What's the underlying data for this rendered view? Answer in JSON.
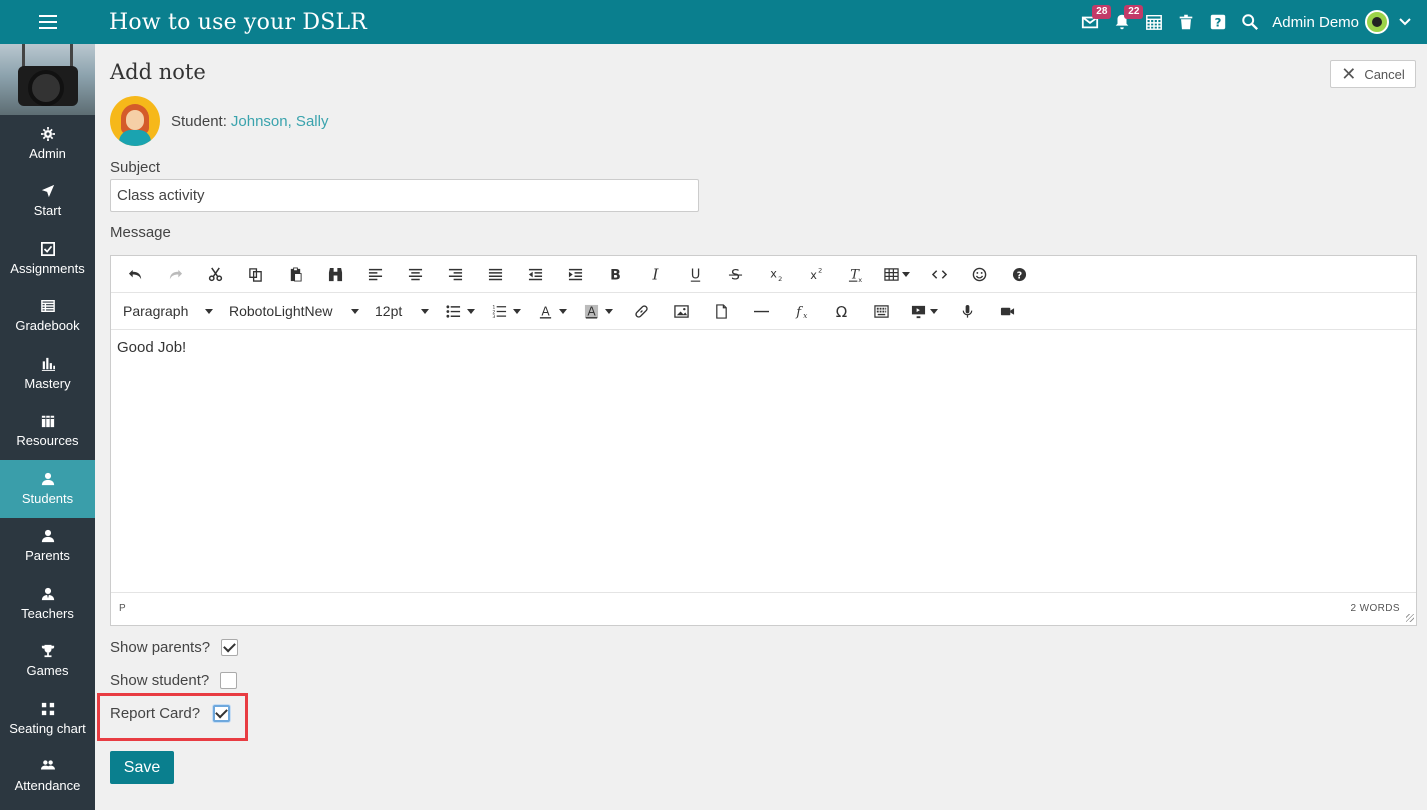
{
  "header": {
    "title": "How to use your DSLR",
    "messages_badge": "28",
    "notifications_badge": "22",
    "user_name": "Admin Demo"
  },
  "sidebar": {
    "items": [
      {
        "label": "Admin",
        "icon": "gear-icon"
      },
      {
        "label": "Start",
        "icon": "navigation-arrow-icon"
      },
      {
        "label": "Assignments",
        "icon": "checkbox-icon"
      },
      {
        "label": "Gradebook",
        "icon": "gradebook-icon"
      },
      {
        "label": "Mastery",
        "icon": "bar-chart-icon"
      },
      {
        "label": "Resources",
        "icon": "books-icon"
      },
      {
        "label": "Students",
        "icon": "user-icon",
        "active": true
      },
      {
        "label": "Parents",
        "icon": "user-icon"
      },
      {
        "label": "Teachers",
        "icon": "user-icon"
      },
      {
        "label": "Games",
        "icon": "trophy-icon"
      },
      {
        "label": "Seating chart",
        "icon": "grid-icon"
      },
      {
        "label": "Attendance",
        "icon": "users-icon"
      }
    ]
  },
  "page": {
    "title": "Add note",
    "cancel_label": "Cancel",
    "student_label": "Student:",
    "student_name": "Johnson, Sally",
    "subject_label": "Subject",
    "subject_value": "Class activity",
    "message_label": "Message"
  },
  "editor": {
    "block_format": "Paragraph",
    "font_family": "RobotoLightNew",
    "font_size": "12pt",
    "content": "Good Job!",
    "path": "P",
    "word_count": "2 WORDS"
  },
  "options": {
    "show_parents_label": "Show parents?",
    "show_parents_checked": true,
    "show_student_label": "Show student?",
    "show_student_checked": false,
    "report_card_label": "Report Card?",
    "report_card_checked": true
  },
  "save_label": "Save",
  "colors": {
    "topbar": "#0a7f8e",
    "sidebar": "#2c3740",
    "active_nav": "#3a9eaa",
    "link": "#3aa3ad",
    "highlight": "#e83c42",
    "badge": "#c23a68"
  }
}
